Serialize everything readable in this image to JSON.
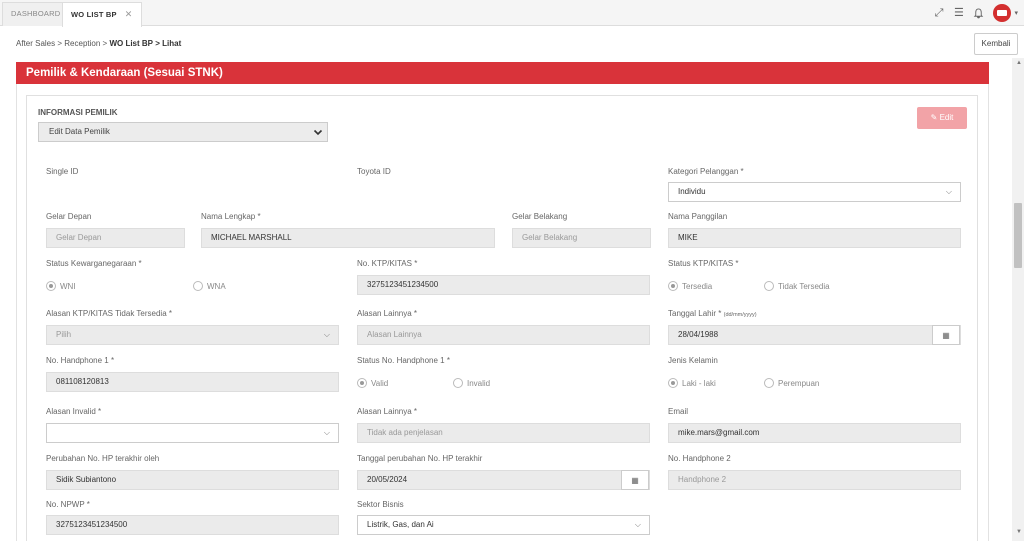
{
  "tabs": [
    {
      "label": "DASHBOARD"
    },
    {
      "label": "WO LIST BP",
      "close": "✕"
    }
  ],
  "breadcrumb": {
    "items": [
      "After Sales",
      "Reception",
      "WO List BP"
    ],
    "current": "Lihat",
    "sep": ">"
  },
  "back_label": "Kembali",
  "section_title": "Pemilik & Kendaraan (Sesuai STNK)",
  "info_title": "INFORMASI PEMILIK",
  "edit_owner_select": "Edit Data Pemilik",
  "edit_label": "Edit",
  "fields": {
    "single_id": {
      "label": "Single ID"
    },
    "toyota_id": {
      "label": "Toyota ID"
    },
    "kategori": {
      "label": "Kategori Pelanggan *",
      "value": "Individu"
    },
    "gelar_depan": {
      "label": "Gelar Depan",
      "placeholder": "Gelar Depan"
    },
    "nama_lengkap": {
      "label": "Nama Lengkap *",
      "value": "MICHAEL MARSHALL"
    },
    "gelar_belakang": {
      "label": "Gelar Belakang",
      "placeholder": "Gelar Belakang"
    },
    "nama_panggilan": {
      "label": "Nama Panggilan",
      "value": "MIKE"
    },
    "kewarganegaraan": {
      "label": "Status Kewarganegaraan *",
      "opt1": "WNI",
      "opt2": "WNA"
    },
    "ktp": {
      "label": "No. KTP/KITAS *",
      "value": "3275123451234500"
    },
    "status_ktp": {
      "label": "Status KTP/KITAS *",
      "opt1": "Tersedia",
      "opt2": "Tidak Tersedia"
    },
    "alasan_ktp": {
      "label": "Alasan KTP/KITAS Tidak Tersedia *",
      "value": "Pilih"
    },
    "alasan_lainnya1": {
      "label": "Alasan Lainnya *",
      "placeholder": "Alasan Lainnya"
    },
    "tanggal_lahir": {
      "label": "Tanggal Lahir *",
      "hint": "(dd/mm/yyyy)",
      "value": "28/04/1988"
    },
    "hp1": {
      "label": "No. Handphone 1 *",
      "value": "081108120813"
    },
    "status_hp1": {
      "label": "Status No. Handphone 1 *",
      "opt1": "Valid",
      "opt2": "Invalid"
    },
    "jenis_kelamin": {
      "label": "Jenis Kelamin",
      "opt1": "Laki - laki",
      "opt2": "Perempuan"
    },
    "alasan_invalid": {
      "label": "Alasan Invalid *",
      "value": ""
    },
    "alasan_lainnya2": {
      "label": "Alasan Lainnya *",
      "placeholder": "Tidak ada penjelasan"
    },
    "email": {
      "label": "Email",
      "value": "mike.mars@gmail.com"
    },
    "perubahan_hp": {
      "label": "Perubahan No. HP terakhir oleh",
      "value": "Sidik Subiantono"
    },
    "tanggal_perubahan": {
      "label": "Tanggal perubahan No. HP terakhir",
      "value": "20/05/2024"
    },
    "hp2": {
      "label": "No. Handphone 2",
      "placeholder": "Handphone 2"
    },
    "npwp": {
      "label": "No. NPWP *",
      "value": "3275123451234500"
    },
    "sektor": {
      "label": "Sektor Bisnis",
      "value": "Listrik, Gas, dan Ai"
    }
  },
  "icons": {
    "fullscreen": "fullscreen-icon",
    "menu": "menu-icon",
    "bell": "bell-icon",
    "calendar": "calendar-icon",
    "pencil": "pencil-icon"
  },
  "colors": {
    "accent": "#d9333a",
    "edit_button": "#f2a3a7"
  }
}
